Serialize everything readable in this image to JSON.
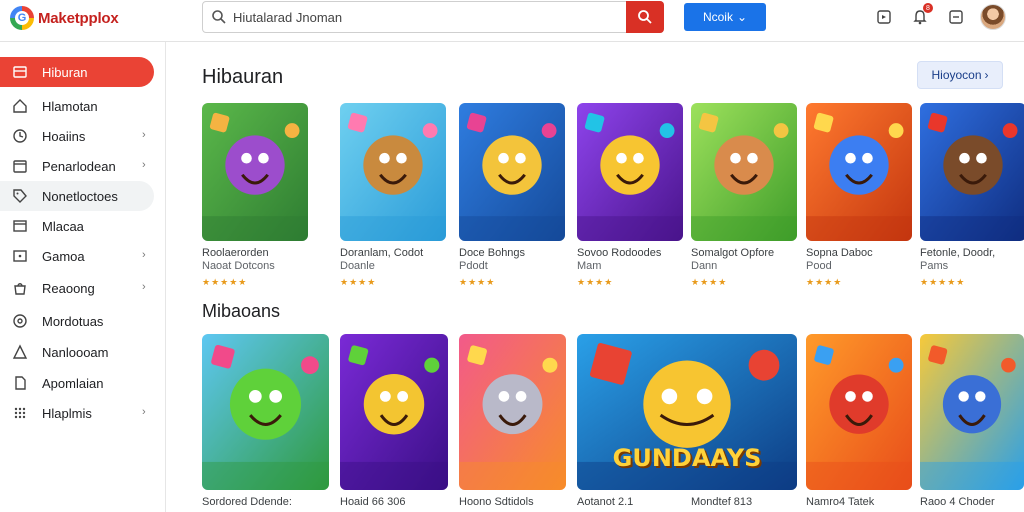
{
  "app": {
    "name": "Maketpplox"
  },
  "search": {
    "value": "Hiutalarad Jnoman",
    "placeholder": ""
  },
  "header": {
    "mode_button": "Ncoik"
  },
  "notifications": {
    "badge": "8"
  },
  "sidebar": {
    "items": [
      {
        "label": "Hiburan",
        "icon": "store-icon",
        "chevron": false,
        "state": "active"
      },
      {
        "label": "Hlamotan",
        "icon": "home-icon",
        "chevron": false,
        "state": ""
      },
      {
        "label": "Hoaiins",
        "icon": "clock-icon",
        "chevron": true,
        "state": ""
      },
      {
        "label": "Penarlodean",
        "icon": "calendar-icon",
        "chevron": true,
        "state": ""
      },
      {
        "label": "Nonetloctoes",
        "icon": "tag-icon",
        "chevron": false,
        "state": "hover"
      },
      {
        "label": "Mlacaa",
        "icon": "window-icon",
        "chevron": false,
        "state": ""
      },
      {
        "label": "Gamoa",
        "icon": "gamepad-icon",
        "chevron": true,
        "state": ""
      },
      {
        "label": "Reaoong",
        "icon": "bag-icon",
        "chevron": true,
        "state": ""
      },
      {
        "label": "Mordotuas",
        "icon": "circle-icon",
        "chevron": false,
        "state": ""
      },
      {
        "label": "Nanloooam",
        "icon": "person-icon",
        "chevron": false,
        "state": ""
      },
      {
        "label": "Apomlaian",
        "icon": "document-icon",
        "chevron": false,
        "state": ""
      },
      {
        "label": "Hlaplmis",
        "icon": "grid-icon",
        "chevron": true,
        "state": ""
      }
    ]
  },
  "main": {
    "section1_title": "Hibauran",
    "sort_button": "Hioyocon",
    "section2_title": "Mibaoans",
    "row1": [
      {
        "title": "Roolaerorden",
        "subtitle": "Naoat Dotcons",
        "stars": "★★★★★",
        "art": "hero-purple"
      },
      {
        "title": "Doranlam, Codot",
        "subtitle": "Doanle",
        "stars": "★★★★",
        "art": "kangaroo"
      },
      {
        "title": "Doce Bohngs",
        "subtitle": "Pdodt",
        "stars": "★★★★",
        "art": "blocks"
      },
      {
        "title": "Sovoo Rodoodes",
        "subtitle": "Mam",
        "stars": "★★★★",
        "art": "notebook"
      },
      {
        "title": "Somalgot Opfore",
        "subtitle": "Dann",
        "stars": "★★★★",
        "art": "boy"
      },
      {
        "title": "Sopna Daboc",
        "subtitle": "Pood",
        "stars": "★★★★",
        "art": "alien"
      },
      {
        "title": "Fetonle, Doodr,",
        "subtitle": "Pams",
        "stars": "★★★★★",
        "art": "pirate"
      }
    ],
    "row2": [
      {
        "title": "Sordored Ddende:",
        "art": "smiley"
      },
      {
        "title": "Hoaid 66 306",
        "art": "dice"
      },
      {
        "title": "Hoono Sdtidols",
        "art": "controller"
      },
      {
        "title": "Aotanot 2.1",
        "art": "gundays",
        "wide": true,
        "banner": "GUNDAAYS"
      },
      {
        "title": "Mondtef 813",
        "art": ""
      },
      {
        "title": "Namro4 Tatek",
        "art": "redhair"
      },
      {
        "title": "Raoo 4 Choder",
        "art": "kid"
      }
    ]
  },
  "colors": {
    "accent": "#ea4335",
    "primary": "#1a73e8"
  }
}
